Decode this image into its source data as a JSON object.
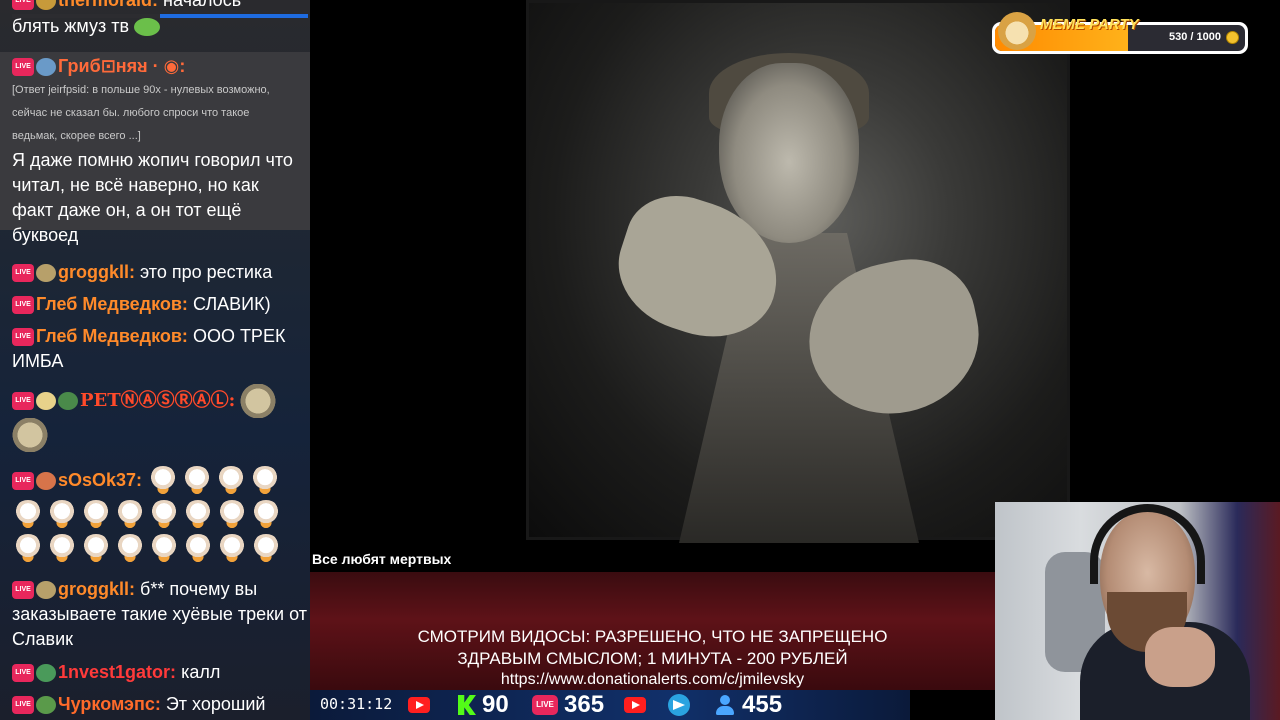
{
  "chat": {
    "messages": [
      {
        "user": "thermoraid:",
        "text": "началось",
        "user_color": "#ff8a2a"
      },
      {
        "user": "",
        "text": "блять жмуз тв",
        "user_color": "#ff8a2a"
      },
      {
        "user": "Гриб⊡няᴚ ·  ◉:",
        "reply": "[Ответ jeirfpsid: в польше 90х - нулевых возможно, сейчас не сказал бы. любого спроси что такое ведьмак, скорее всего ...]",
        "text": "Я даже помню жопич говорил что читал, не всё наверно, но как факт даже он, а он тот ещё буквоед",
        "user_color": "#ff6a3a"
      },
      {
        "user": "groggkll:",
        "text": "это про рестика",
        "user_color": "#ff8a2a"
      },
      {
        "user": "Глеб Медведков:",
        "text": "СЛАВИК)",
        "user_color": "#ff8a2a"
      },
      {
        "user": "Глеб Медведков:",
        "text": "ООО ТРЕК ИМБА",
        "user_color": "#ff8a2a"
      },
      {
        "user": "PETⓃⒶⓈⓇⒶⓁ:",
        "text": "",
        "user_color": "#ff4a2a"
      },
      {
        "user": "sOsOk37:",
        "text": "",
        "user_color": "#ff8a2a"
      },
      {
        "user": "groggkll:",
        "text": "б** почему вы заказываете такие хуёвые треки от Славик",
        "user_color": "#ff8a2a"
      },
      {
        "user": "1nvest1gator:",
        "text": "калл",
        "user_color": "#ff3a3a"
      },
      {
        "user": "Чуркомэпс:",
        "text": "Эт хороший",
        "user_color": "#ff6a2a"
      }
    ],
    "live_label": "LIVE"
  },
  "video": {
    "title": "Все любят мертвых"
  },
  "banner": {
    "line1": "СМОТРИМ ВИДОСЫ: РАЗРЕШЕНО, ЧТО НЕ ЗАПРЕЩЕНО",
    "line2": "ЗДРАВЫМ СМЫСЛОМ; 1 МИНУТА - 200 РУБЛЕЙ",
    "line3": "https://www.donationalerts.com/c/jmilevsky"
  },
  "stats": {
    "timer": "00:31:12",
    "kick_count": "90",
    "live_count": "365",
    "viewers": "455",
    "live_label": "LIVE"
  },
  "meme_party": {
    "title": "MEME PARTY",
    "count": "530 / 1000",
    "progress": 0.53,
    "accent": "#ff8a00"
  }
}
